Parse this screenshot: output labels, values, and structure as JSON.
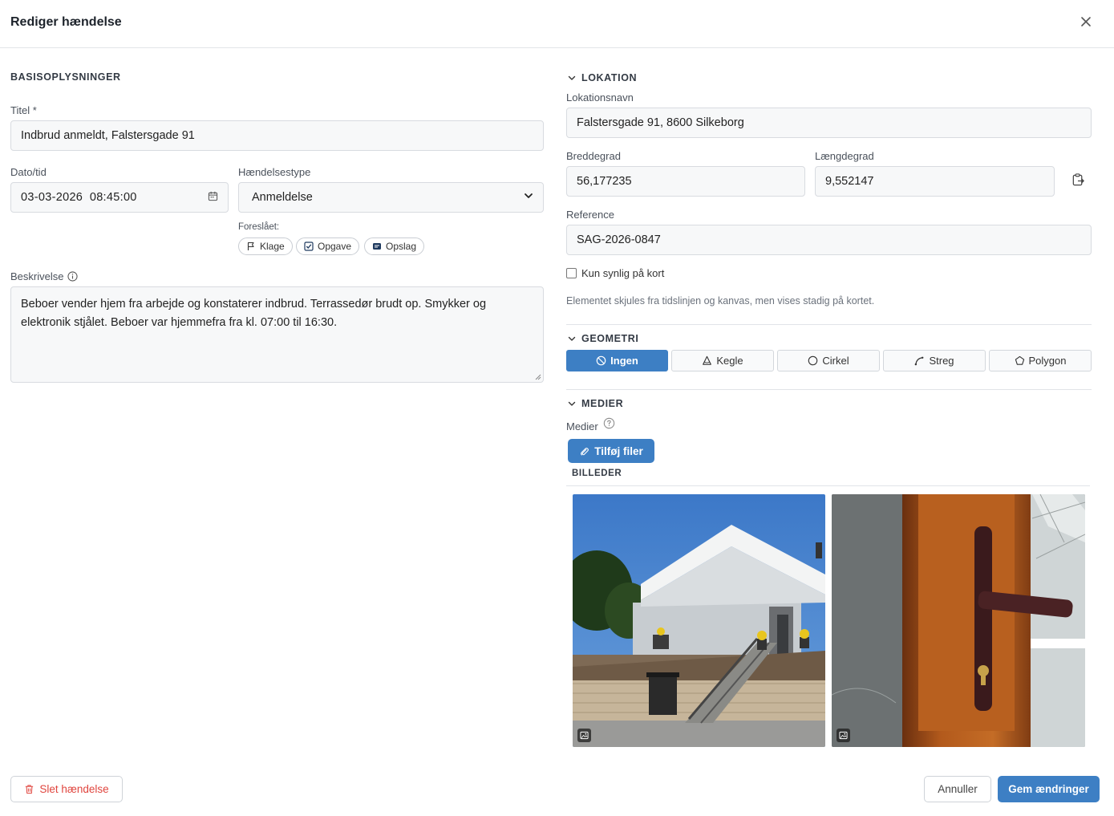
{
  "dialog": {
    "title": "Rediger hændelse"
  },
  "basis": {
    "section_title": "BASISOPLYSNINGER",
    "title_label": "Titel *",
    "title_value": "Indbrud anmeldt, Falstersgade 91",
    "datetime_label": "Dato/tid",
    "datetime_value": "03-03-2026  08:45:00",
    "type_label": "Hændelsestype",
    "type_value": "Anmeldelse",
    "suggested_label": "Foreslået:",
    "suggestions": [
      "Klage",
      "Opgave",
      "Opslag"
    ],
    "description_label": "Beskrivelse",
    "description_value": "Beboer vender hjem fra arbejde og konstaterer indbrud. Terrassedør brudt op. Smykker og elektronik stjålet. Beboer var hjemmefra fra kl. 07:00 til 16:30."
  },
  "location": {
    "section_title": "LOKATION",
    "name_label": "Lokationsnavn",
    "name_value": "Falstersgade 91, 8600 Silkeborg",
    "lat_label": "Breddegrad",
    "lat_value": "56,177235",
    "lng_label": "Længdegrad",
    "lng_value": "9,552147",
    "reference_label": "Reference",
    "reference_value": "SAG-2026-0847",
    "map_only_label": "Kun synlig på kort",
    "map_only_checked": false,
    "map_only_hint": "Elementet skjules fra tidslinjen og kanvas, men vises stadig på kortet."
  },
  "geometry": {
    "section_title": "GEOMETRI",
    "options": [
      "Ingen",
      "Kegle",
      "Cirkel",
      "Streg",
      "Polygon"
    ],
    "selected": "Ingen"
  },
  "media": {
    "section_title": "MEDIER",
    "media_label": "Medier",
    "add_files_label": "Tilføj filer",
    "images_heading": "BILLEDER"
  },
  "footer": {
    "delete_label": "Slet hændelse",
    "cancel_label": "Annuller",
    "save_label": "Gem ændringer"
  },
  "colors": {
    "primary": "#3d7fc4",
    "danger": "#e0453e"
  }
}
